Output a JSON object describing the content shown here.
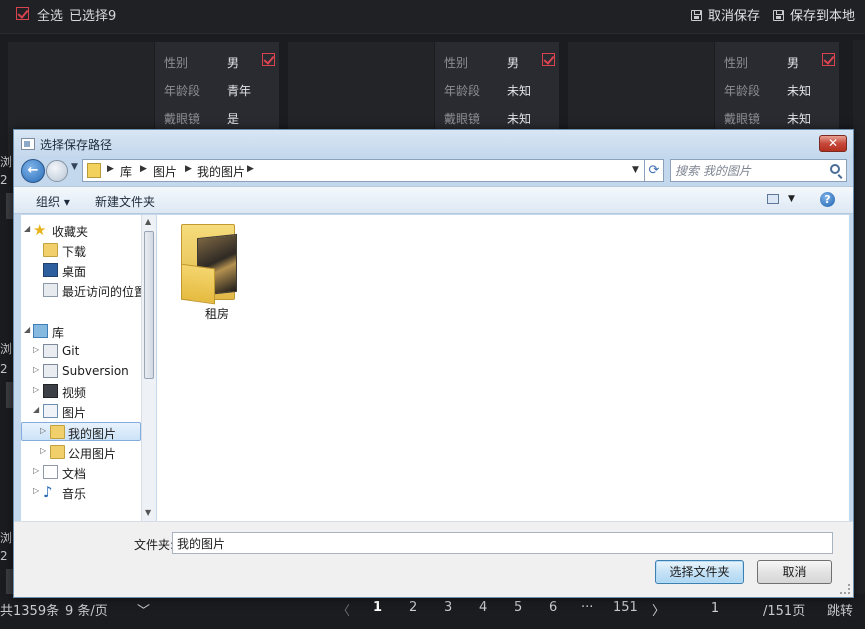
{
  "topbar": {
    "select_all": "全选",
    "selected_count": "已选择9",
    "cancel_save": "取消保存",
    "save_local": "保存到本地"
  },
  "cards": [
    {
      "rows": [
        {
          "k": "性别",
          "v": "男"
        },
        {
          "k": "年龄段",
          "v": "青年"
        },
        {
          "k": "戴眼镜",
          "v": "是"
        }
      ]
    },
    {
      "rows": [
        {
          "k": "性别",
          "v": "男"
        },
        {
          "k": "年龄段",
          "v": "未知"
        },
        {
          "k": "戴眼镜",
          "v": "未知"
        }
      ]
    },
    {
      "rows": [
        {
          "k": "性别",
          "v": "男"
        },
        {
          "k": "年龄段",
          "v": "未知"
        },
        {
          "k": "戴眼镜",
          "v": "未知"
        }
      ]
    }
  ],
  "left_fragments": [
    "浏",
    "2",
    "浏",
    "2",
    "浏",
    "2"
  ],
  "pager": {
    "total": "共1359条",
    "per_page": "9 条/页",
    "pages": [
      "1",
      "2",
      "3",
      "4",
      "5",
      "6",
      "···",
      "151"
    ],
    "current_input": "1",
    "total_pages": "/151页",
    "jump": "跳转"
  },
  "dialog": {
    "title": "选择保存路径",
    "breadcrumbs": [
      "库",
      "图片",
      "我的图片"
    ],
    "search_placeholder": "搜索 我的图片",
    "toolbar": {
      "organize": "组织 ▾",
      "new_folder": "新建文件夹"
    },
    "nav": [
      {
        "label": "收藏夹",
        "icon": "star-icon"
      },
      {
        "label": "下载",
        "icon": "download-folder-icon"
      },
      {
        "label": "桌面",
        "icon": "desktop-icon"
      },
      {
        "label": "最近访问的位置",
        "icon": "recent-places-icon"
      },
      {
        "label": "库",
        "icon": "library-icon"
      },
      {
        "label": "Git",
        "icon": "git-library-icon"
      },
      {
        "label": "Subversion",
        "icon": "subversion-library-icon"
      },
      {
        "label": "视频",
        "icon": "video-library-icon"
      },
      {
        "label": "图片",
        "icon": "pictures-library-icon"
      },
      {
        "label": "我的图片",
        "icon": "my-pictures-folder-icon"
      },
      {
        "label": "公用图片",
        "icon": "public-pictures-folder-icon"
      },
      {
        "label": "文档",
        "icon": "documents-library-icon"
      },
      {
        "label": "音乐",
        "icon": "music-library-icon"
      }
    ],
    "folders": [
      {
        "name": "租房"
      }
    ],
    "folder_field_label": "文件夹:",
    "folder_field_value": "我的图片",
    "select_button": "选择文件夹",
    "cancel_button": "取消"
  }
}
